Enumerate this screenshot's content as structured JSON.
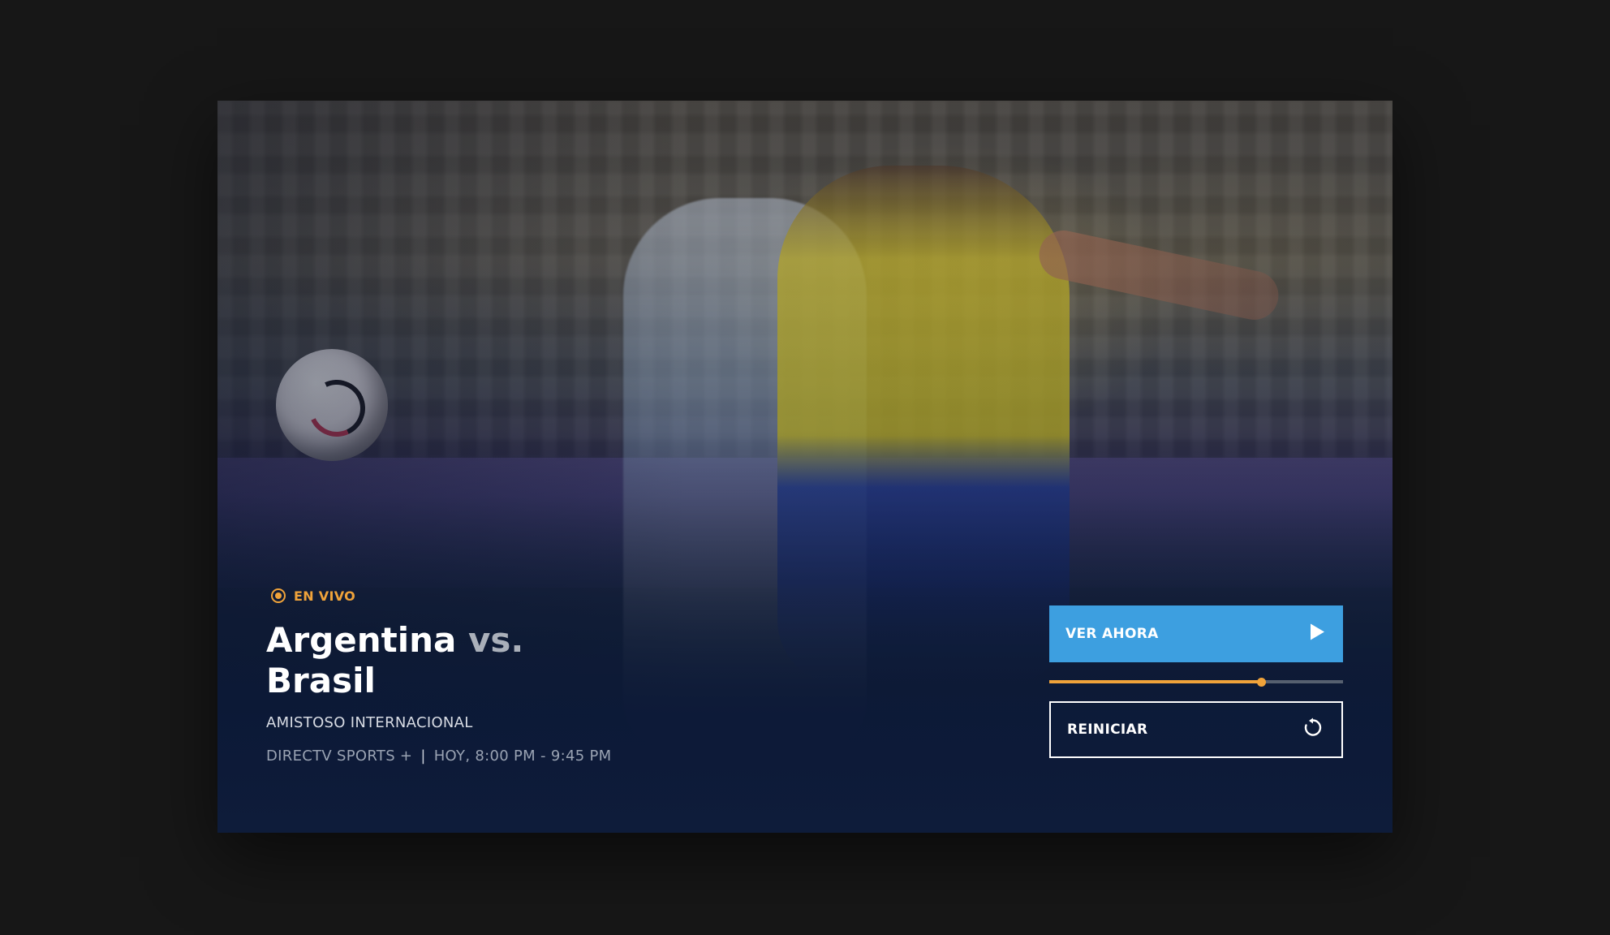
{
  "live_badge": {
    "label": "EN VIVO",
    "color": "#f0a33a"
  },
  "match": {
    "team_home": "Argentina",
    "vs_label": "vs.",
    "team_away": "Brasil",
    "competition": "AMISTOSO INTERNACIONAL",
    "channel": "DIRECTV SPORTS +",
    "separator": "|",
    "schedule": "HOY, 8:00 PM - 9:45 PM"
  },
  "actions": {
    "watch_now": {
      "label": "VER AHORA",
      "icon": "play-icon",
      "color": "#3d9fe0"
    },
    "restart": {
      "label": "REINICIAR",
      "icon": "restart-icon"
    }
  },
  "playback": {
    "progress_fraction": 0.72,
    "progress_color": "#f0a33a"
  },
  "hero_image": {
    "subject": "football-players-image",
    "ball": "soccer-ball-image"
  }
}
